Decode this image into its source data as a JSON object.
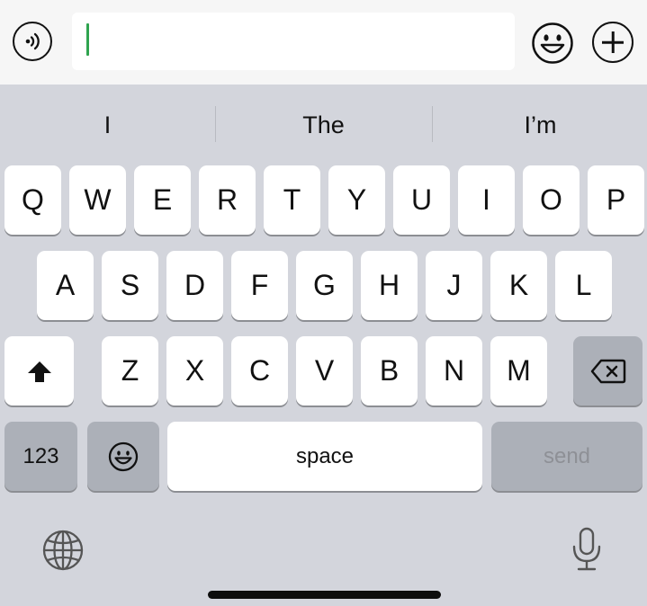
{
  "composer": {
    "input_value": "",
    "voice_icon": "speaker-wave-icon",
    "emoji_icon": "smiley-icon",
    "attach_icon": "plus-icon"
  },
  "suggestions": [
    "I",
    "The",
    "I’m"
  ],
  "keyboard": {
    "row1": [
      "Q",
      "W",
      "E",
      "R",
      "T",
      "Y",
      "U",
      "I",
      "O",
      "P"
    ],
    "row2": [
      "A",
      "S",
      "D",
      "F",
      "G",
      "H",
      "J",
      "K",
      "L"
    ],
    "row3": [
      "Z",
      "X",
      "C",
      "V",
      "B",
      "N",
      "M"
    ],
    "numbers_label": "123",
    "space_label": "space",
    "send_label": "send",
    "shift_icon": "shift-arrow-icon",
    "delete_icon": "backspace-icon",
    "emoji_key_icon": "emoji-face-icon",
    "globe_icon": "globe-icon",
    "mic_icon": "microphone-icon"
  }
}
